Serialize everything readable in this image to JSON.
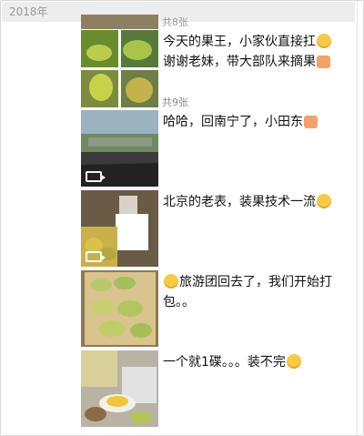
{
  "header": {
    "year": "2018年"
  },
  "top_partial": {
    "count": "共8张"
  },
  "posts": [
    {
      "text_line1": "今天的果王，小家伙直接扛",
      "text_line2": "谢谢老妹，带大部队来摘果",
      "emoji1": "smile-emoji",
      "emoji2": "girl-emoji",
      "count": "共9张"
    },
    {
      "text": "哈哈，回南宁了，小田东",
      "emoji": "girl-emoji",
      "media": "video"
    },
    {
      "text": "北京的老表，装果技术一流",
      "emoji": "sweat-emoji",
      "media": "video"
    },
    {
      "text_line1": "旅游团回去了，我们开始打",
      "text_line2": "包。。",
      "emoji": "sweat-emoji"
    },
    {
      "text": "一个就1碟。。。装不完",
      "emoji": "sweat-emoji"
    }
  ]
}
